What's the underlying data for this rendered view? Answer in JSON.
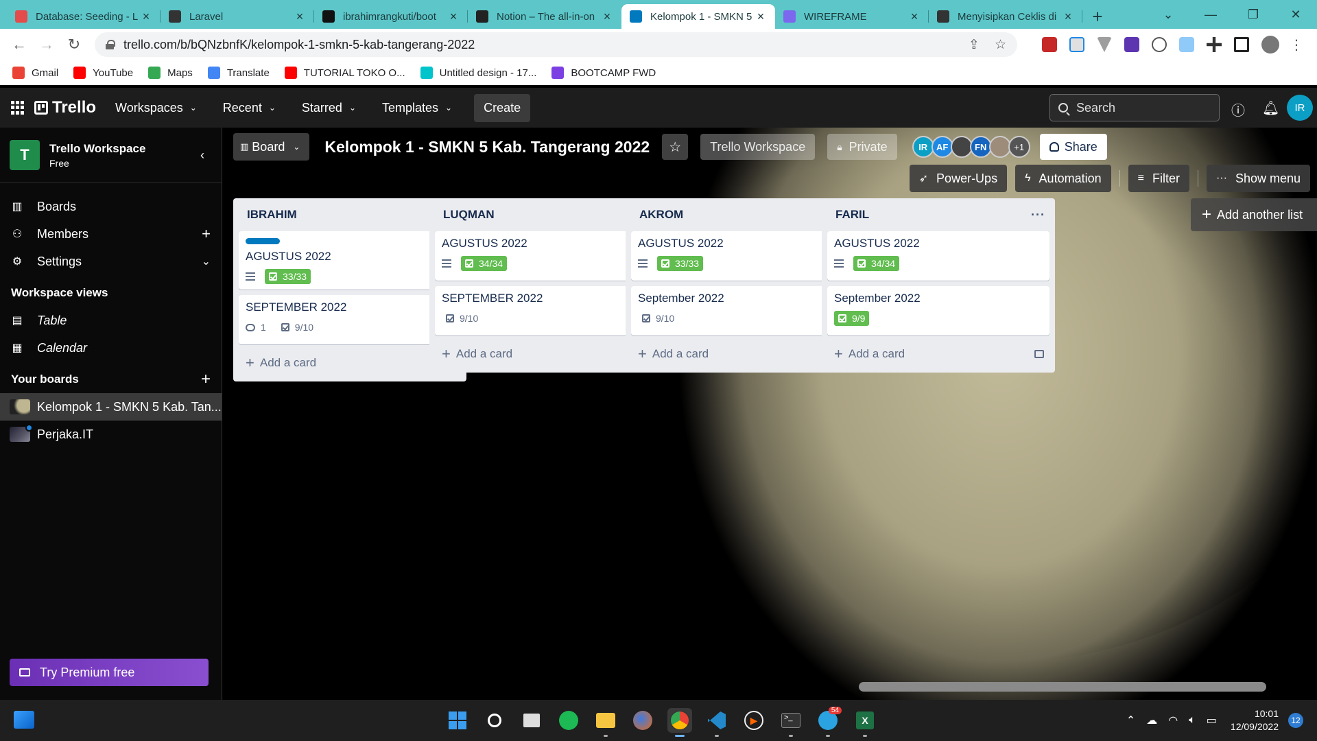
{
  "browser": {
    "tabs": [
      {
        "title": "Database: Seeding - L",
        "color": "#e44c4c"
      },
      {
        "title": "Laravel",
        "color": "#333333"
      },
      {
        "title": "ibrahimrangkuti/boot",
        "color": "#111111"
      },
      {
        "title": "Notion – The all-in-on",
        "color": "#222222"
      },
      {
        "title": "Kelompok 1 - SMKN 5",
        "color": "#0079bf"
      },
      {
        "title": "WIREFRAME",
        "color": "#7b68ee"
      },
      {
        "title": "Menyisipkan Ceklis di",
        "color": "#333333"
      }
    ],
    "url": "trello.com/b/bQNzbnfK/kelompok-1-smkn-5-kab-tangerang-2022",
    "bookmarks": [
      {
        "label": "Gmail",
        "color": "#ea4335"
      },
      {
        "label": "YouTube",
        "color": "#ff0000"
      },
      {
        "label": "Maps",
        "color": "#34a853"
      },
      {
        "label": "Translate",
        "color": "#4285f4"
      },
      {
        "label": "TUTORIAL TOKO O...",
        "color": "#ff0000"
      },
      {
        "label": "Untitled design - 17...",
        "color": "#00c4cc"
      },
      {
        "label": "BOOTCAMP FWD",
        "color": "#7b3fe4"
      }
    ]
  },
  "trello_header": {
    "brand": "Trello",
    "menu": [
      "Workspaces",
      "Recent",
      "Starred",
      "Templates"
    ],
    "create": "Create",
    "search_placeholder": "Search",
    "user_initials": "IR"
  },
  "sidebar": {
    "workspace_initial": "T",
    "workspace_name": "Trello Workspace",
    "workspace_plan": "Free",
    "items": [
      {
        "label": "Boards",
        "icon": "boards-icon"
      },
      {
        "label": "Members",
        "icon": "members-icon"
      },
      {
        "label": "Settings",
        "icon": "settings-icon"
      }
    ],
    "views_title": "Workspace views",
    "views": [
      {
        "label": "Table",
        "icon": "table-icon"
      },
      {
        "label": "Calendar",
        "icon": "calendar-icon"
      }
    ],
    "boards_title": "Your boards",
    "boards": [
      {
        "label": "Kelompok 1 - SMKN 5 Kab. Tan...",
        "active": true
      },
      {
        "label": "Perjaka.IT",
        "active": false
      }
    ],
    "premium": "Try Premium free"
  },
  "board": {
    "view": "Board",
    "title": "Kelompok 1 - SMKN 5 Kab. Tangerang 2022",
    "workspace": "Trello Workspace",
    "visibility": "Private",
    "members": [
      {
        "initials": "IR",
        "color": "#0c9fc5"
      },
      {
        "initials": "AF",
        "color": "#1e88e5"
      },
      {
        "initials": "",
        "color": "#444444"
      },
      {
        "initials": "FN",
        "color": "#1565c0"
      },
      {
        "initials": "",
        "color": "#9e8c7a"
      }
    ],
    "more_members": "+1",
    "share": "Share",
    "actions": [
      "Power-Ups",
      "Automation",
      "Filter",
      "Show menu"
    ],
    "add_list": "Add another list",
    "add_card": "Add a card",
    "lists": [
      {
        "name": "IBRAHIM",
        "cards": [
          {
            "title": "AGUSTUS 2022",
            "label": true,
            "desc": true,
            "checklist": "33/33",
            "complete": true,
            "comments": ""
          },
          {
            "title": "SEPTEMBER 2022",
            "label": false,
            "desc": false,
            "checklist": "9/10",
            "complete": false,
            "comments": "1"
          }
        ]
      },
      {
        "name": "LUQMAN",
        "cards": [
          {
            "title": "AGUSTUS 2022",
            "label": false,
            "desc": true,
            "checklist": "34/34",
            "complete": true,
            "comments": ""
          },
          {
            "title": "SEPTEMBER 2022",
            "label": false,
            "desc": false,
            "checklist": "9/10",
            "complete": false,
            "comments": ""
          }
        ]
      },
      {
        "name": "AKROM",
        "cards": [
          {
            "title": "AGUSTUS 2022",
            "label": false,
            "desc": true,
            "checklist": "33/33",
            "complete": true,
            "comments": ""
          },
          {
            "title": "September 2022",
            "label": false,
            "desc": false,
            "checklist": "9/10",
            "complete": false,
            "comments": ""
          }
        ]
      },
      {
        "name": "FARIL",
        "cards": [
          {
            "title": "AGUSTUS 2022",
            "label": false,
            "desc": true,
            "checklist": "34/34",
            "complete": true,
            "comments": ""
          },
          {
            "title": "September 2022",
            "label": false,
            "desc": false,
            "checklist": "9/9",
            "complete": true,
            "comments": ""
          }
        ]
      }
    ]
  },
  "taskbar": {
    "time": "10:01",
    "date": "12/09/2022",
    "notifications": "12",
    "telegram_badge": "54"
  }
}
